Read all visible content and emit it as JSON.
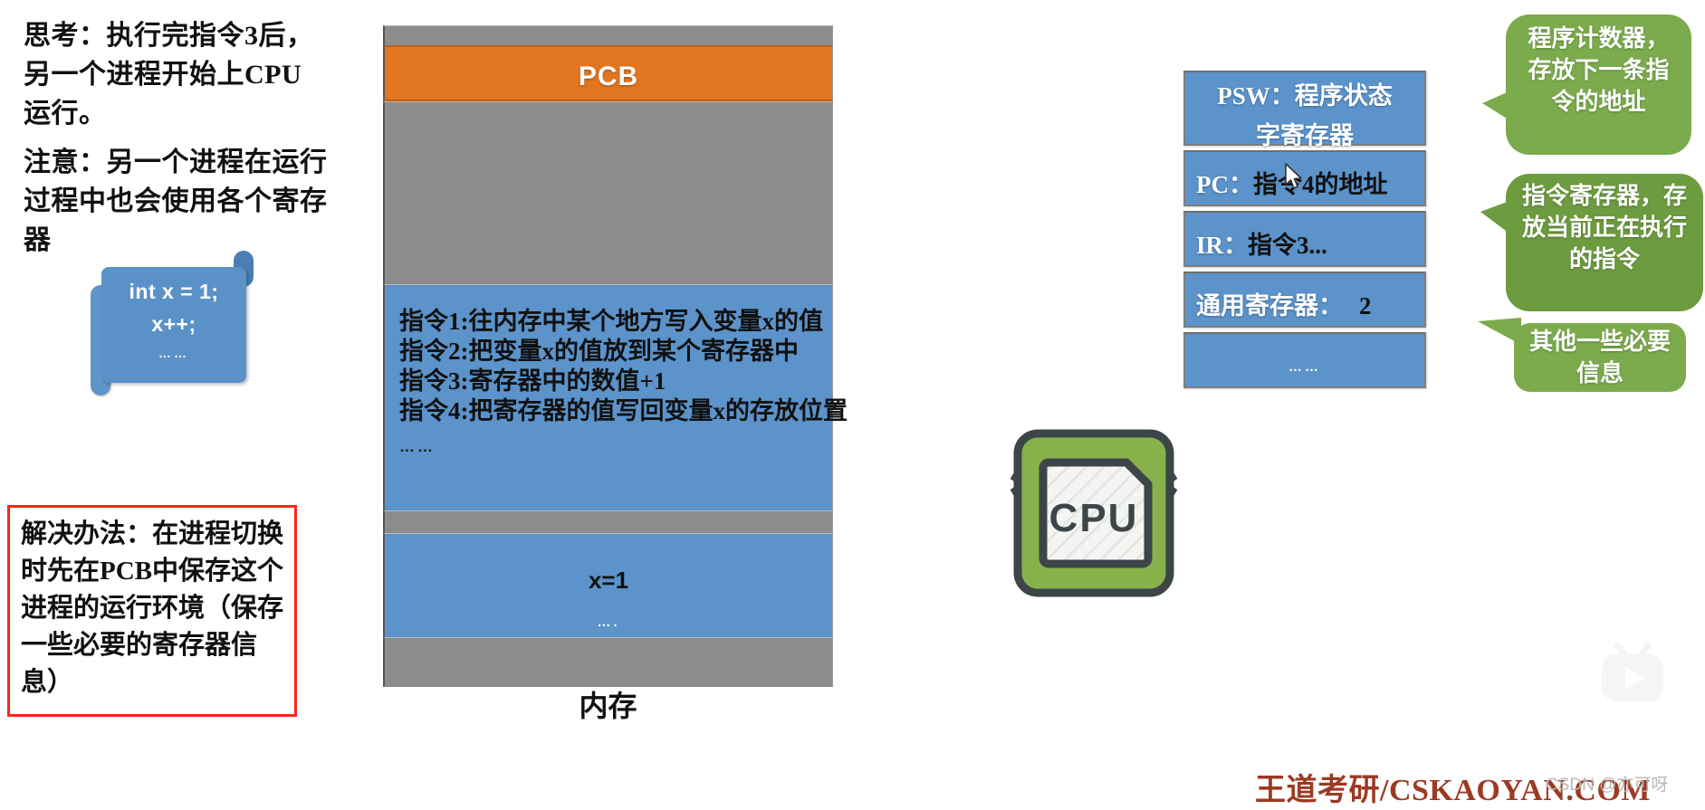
{
  "notes": {
    "think": "思考：执行完指令3后，另一个进程开始上CPU运行。",
    "attention": "注意：另一个进程在运行过程中也会使用各个寄存器",
    "solution": "解决办法：在进程切换时先在PCB中保存这个进程的运行环境（保存一些必要的寄存器信息）"
  },
  "code_scroll": {
    "line1": "int x = 1;",
    "line2": "x++;",
    "line3": "……"
  },
  "memory": {
    "caption": "内存",
    "pcb_label": "PCB",
    "instructions": [
      "指令1:往内存中某个地方写入变量x的值",
      "指令2:把变量x的值放到某个寄存器中",
      "指令3:寄存器中的数值+1",
      "指令4:把寄存器的值写回变量x的存放位置"
    ],
    "instructions_more": "……",
    "data_value": "x=1",
    "data_more": "…."
  },
  "registers": [
    {
      "name": "PSW",
      "prefix": "",
      "label": "PSW：程序状态",
      "label2": "字寄存器",
      "value": ""
    },
    {
      "name": "PC",
      "prefix": "PC：",
      "value": "指令4的地址"
    },
    {
      "name": "IR",
      "prefix": "IR：",
      "value": "指令3..."
    },
    {
      "name": "GP",
      "prefix": "通用寄存器：",
      "value": "2"
    },
    {
      "name": "MORE",
      "prefix": "",
      "value": "……"
    }
  ],
  "callouts": {
    "pc": "程序计数器，存放下一条指令的地址",
    "ir": "指令寄存器，存放当前正在执行的指令",
    "other": "其他一些必要信息"
  },
  "cpu": {
    "label": "CPU"
  },
  "footer": {
    "brand": "王道考研/CSKAOYAN.COM",
    "watermark": "CSDN @亦可呀"
  },
  "colors": {
    "orange": "#e2751f",
    "blue": "#5b93ca",
    "gray": "#8c8c8c",
    "green_light": "#7bab4c",
    "green_dark": "#6d9b3f",
    "red": "#ff2418",
    "brand": "#9c3a23"
  }
}
